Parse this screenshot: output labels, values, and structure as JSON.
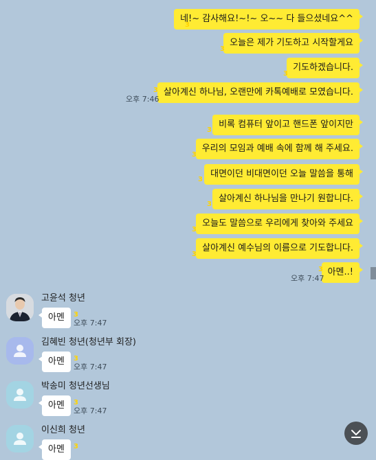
{
  "colors": {
    "background": "#b2c7da",
    "my_bubble": "#ffeb33",
    "other_bubble": "#ffffff",
    "unread": "#ffd400"
  },
  "outgoing": [
    {
      "text": "네!~ 감사해요!~!~ 오~~ 다 들으셨네요^^",
      "unread": "3"
    },
    {
      "text": "오늘은 제가 기도하고 시작할게요",
      "unread": "3"
    },
    {
      "text": "기도하겠습니다.",
      "unread": "3"
    },
    {
      "text": "살아계신 하나님, 오랜만에 카톡예배로 모였습니다.",
      "unread": "3",
      "time": "오후 7:46"
    },
    {
      "text": "비록 컴퓨터 앞이고 핸드폰 앞이지만",
      "unread": "3"
    },
    {
      "text": "우리의 모임과 예배 속에 함께 해 주세요.",
      "unread": "3"
    },
    {
      "text": "대면이던 비대면이던 오늘 말씀을 통해",
      "unread": "3"
    },
    {
      "text": "살아계신 하나님을 만나기 원합니다.",
      "unread": "3"
    },
    {
      "text": "오늘도 말씀으로 우리에게 찾아와 주세요",
      "unread": "3"
    },
    {
      "text": "살아계신 예수님의 이름으로 기도합니다.",
      "unread": "3"
    },
    {
      "text": "아멘..!",
      "unread": "3",
      "time": "오후 7:47"
    }
  ],
  "incoming": [
    {
      "sender": "고윤석 청년",
      "text": "아멘",
      "unread": "3",
      "time": "오후 7:47",
      "avatar": "photo"
    },
    {
      "sender": "김혜빈 청년(청년부 회장)",
      "text": "아멘",
      "unread": "3",
      "time": "오후 7:47",
      "avatar": "default-purple"
    },
    {
      "sender": "박송미 청년선생님",
      "text": "아멘",
      "unread": "3",
      "time": "오후 7:47",
      "avatar": "default-teal"
    },
    {
      "sender": "이신희 청년",
      "text": "아멘",
      "unread": "3",
      "avatar": "default-teal"
    }
  ],
  "icons": {
    "scroll_down": "chevron-down-to-bottom-icon"
  }
}
